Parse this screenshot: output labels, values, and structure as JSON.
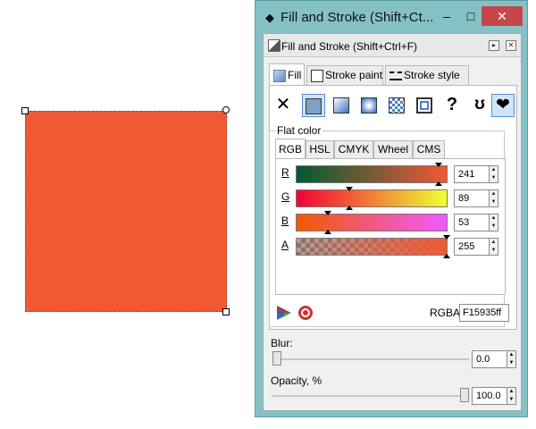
{
  "object": {
    "fill_color": "#f15935"
  },
  "window": {
    "title": "Fill and Stroke (Shift+Ct...",
    "min": "–",
    "max": "□",
    "close": "✕"
  },
  "dock": {
    "title": "Fill and Stroke (Shift+Ctrl+F)",
    "btn_a": "▸",
    "btn_b": "✕"
  },
  "tabs": {
    "fill": "Fill",
    "stroke_paint": "Stroke paint",
    "stroke_style": "Stroke style"
  },
  "paint_types": {
    "none": "✕",
    "unset": "?",
    "evenodd": "ʊ",
    "nonzero": "❤"
  },
  "flat": {
    "label": "Flat color",
    "color_tabs": [
      "RGB",
      "HSL",
      "CMYK",
      "Wheel",
      "CMS"
    ],
    "channels": [
      {
        "label": "R",
        "value": "241",
        "fraction": 0.945
      },
      {
        "label": "G",
        "value": "89",
        "fraction": 0.349
      },
      {
        "label": "B",
        "value": "53",
        "fraction": 0.208
      },
      {
        "label": "A",
        "value": "255",
        "fraction": 1.0
      }
    ],
    "rgba_label": "RGBA:",
    "rgba_value": "F15935ff"
  },
  "blur": {
    "label": "Blur:",
    "value": "0.0",
    "level": 0.0
  },
  "opacity": {
    "label": "Opacity, %",
    "value": "100.0",
    "level": 1.0
  },
  "spinner": {
    "up": "▲",
    "down": "▼"
  }
}
